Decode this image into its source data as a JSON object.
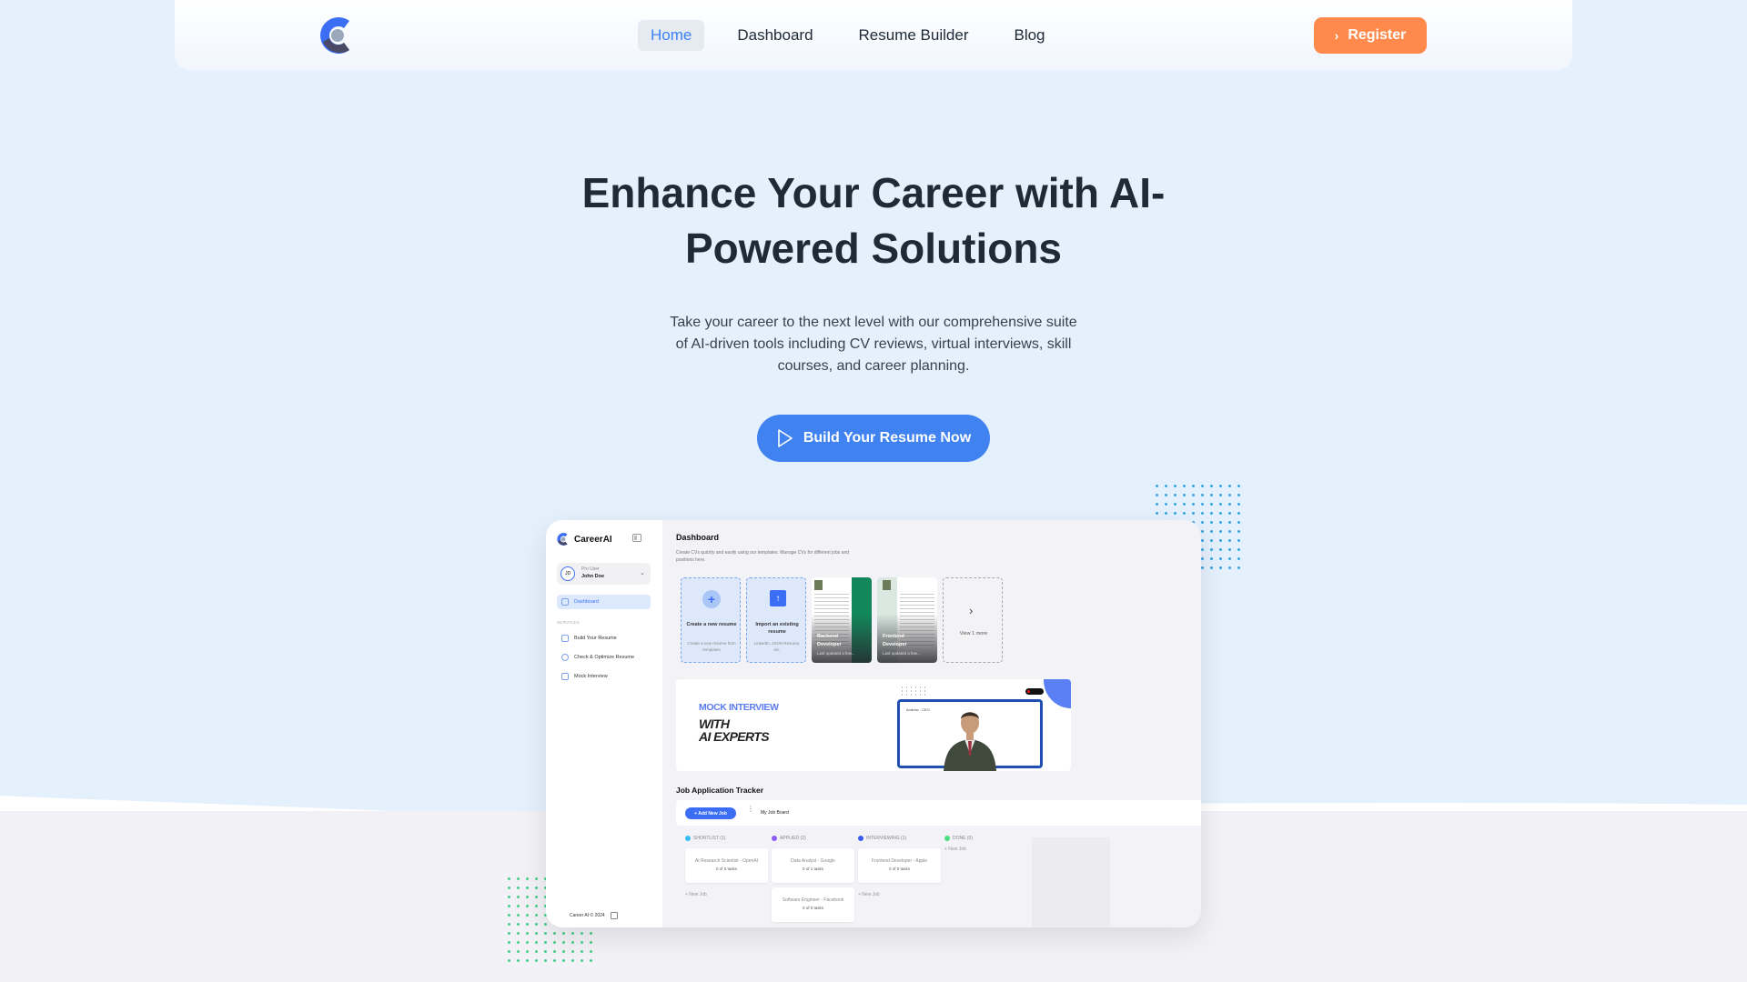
{
  "nav": {
    "logo": "careerai-logo",
    "links": [
      {
        "label": "Home",
        "active": true
      },
      {
        "label": "Dashboard",
        "active": false
      },
      {
        "label": "Resume Builder",
        "active": false
      },
      {
        "label": "Blog",
        "active": false
      }
    ],
    "register_label": "Register"
  },
  "hero": {
    "title": "Enhance Your Career with AI-Powered Solutions",
    "subtitle": "Take your career to the next level with our comprehensive suite of AI-driven tools including CV reviews, virtual interviews, skill courses, and career planning.",
    "cta_label": "Build Your Resume Now"
  },
  "mockup": {
    "brand": "CareerAI",
    "user": {
      "initials": "JD",
      "role": "Pro User",
      "name": "John Doe"
    },
    "nav_active": "Dashboard",
    "section_label": "SERVICES",
    "services": [
      "Build Your Resume",
      "Check & Optimize Resume",
      "Mock Interview"
    ],
    "footer": "Career AI © 2024",
    "dashboard": {
      "title": "Dashboard",
      "description": "Create CVs quickly and easily using our templates. Manage CVs for different jobs and positions here.",
      "cards": [
        {
          "title": "Create a new resume",
          "subtitle": "Create a new resume from templates"
        },
        {
          "title": "Import an existing resume",
          "subtitle": "LinkedIn, JSON Resume, etc."
        },
        {
          "title": "Backend Developer",
          "subtitle": "Last updated a few..."
        },
        {
          "title": "Frontend Developer",
          "subtitle": "Last updated a few..."
        },
        {
          "title": "View 1 more"
        }
      ]
    },
    "banner": {
      "kicker": "MOCK INTERVIEW",
      "line1": "WITH",
      "line2": "AI EXPERTS",
      "frame_label": "Andrew - CEO",
      "rec": "REC"
    },
    "tracker": {
      "title": "Job Application Tracker",
      "add_label": "+ Add New Job",
      "board_name": "My Job Board",
      "new_job_label": "+ New Job",
      "columns": [
        {
          "name": "SHORTLIST (1)",
          "color": "#38bdf8",
          "jobs": [
            {
              "title": "AI Research Scientist - OpenAI",
              "tasks": "0 of 0 tasks"
            }
          ]
        },
        {
          "name": "APPLIED (2)",
          "color": "#8b5cf6",
          "jobs": [
            {
              "title": "Data Analyst - Google",
              "tasks": "0 of 1 tasks"
            },
            {
              "title": "Software Engineer - Facebook",
              "tasks": "0 of 0 tasks"
            }
          ]
        },
        {
          "name": "INTERVIEWING (1)",
          "color": "#3b5bf5",
          "jobs": [
            {
              "title": "Frontend Developer - Apple",
              "tasks": "0 of 0 tasks"
            }
          ]
        },
        {
          "name": "DONE (0)",
          "color": "#4ade80",
          "jobs": []
        }
      ]
    }
  },
  "colors": {
    "accent_blue": "#3f82f0",
    "register_orange": "#ff8a4c",
    "hero_bg": "#e5f0fd"
  }
}
